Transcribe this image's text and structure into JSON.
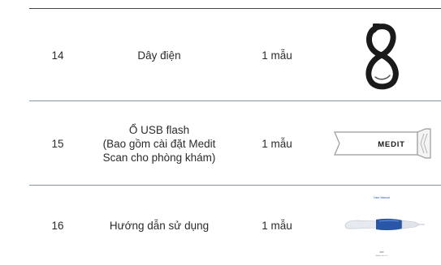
{
  "rows": [
    {
      "no": "14",
      "name": "Dây điện",
      "qty": "1 mẫu",
      "image_icon": "power-cable-icon"
    },
    {
      "no": "15",
      "name": "Ổ USB flash\n(Bao gồm cài đặt Medit\nScan cho phòng khám)",
      "qty": "1 mẫu",
      "image_icon": "usb-flash-drive-icon",
      "usb_label": "MEDIT"
    },
    {
      "no": "16",
      "name": "Hướng dẫn sử dụng",
      "qty": "1 mẫu",
      "image_icon": "user-manual-icon",
      "manual_title": "User Manual",
      "manual_footer_1": "i600",
      "manual_footer_2": "Medit Link v2.x"
    }
  ],
  "colors": {
    "text": "#2b2b2b",
    "separator": "#8a94a8",
    "top_rule": "#444444",
    "manual_blue": "#2a56a8"
  }
}
